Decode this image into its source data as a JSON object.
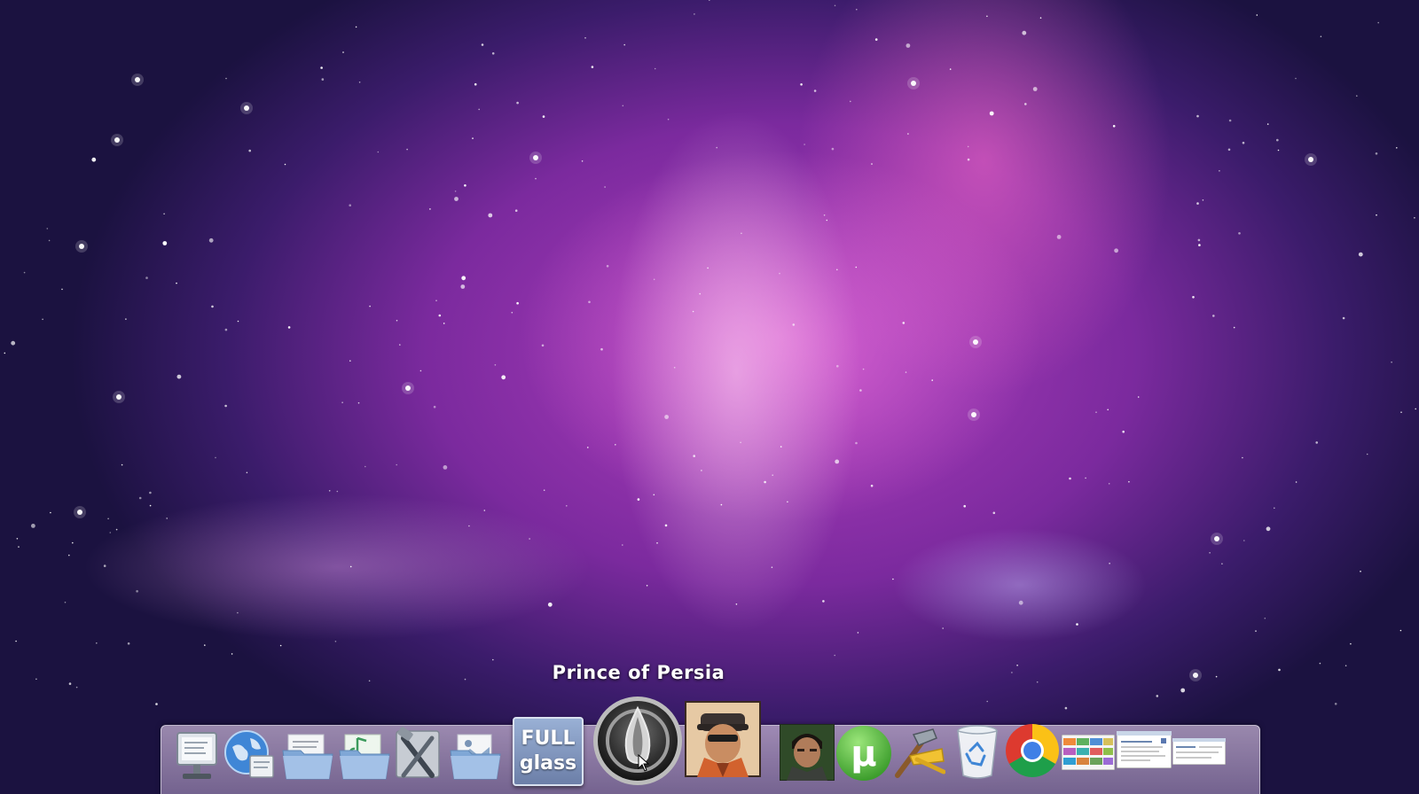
{
  "desktop": {
    "wallpaper": "aurora-galaxy",
    "colors": {
      "sky_dark": "#1b1240",
      "aurora_pink": "#e86ad8",
      "aurora_purple": "#8a3cb0"
    }
  },
  "dock": {
    "tooltip": "Prince of Persia",
    "items": [
      {
        "name": "computer-icon"
      },
      {
        "name": "network-globe-icon"
      },
      {
        "name": "documents-folder-icon"
      },
      {
        "name": "music-folder-icon"
      },
      {
        "name": "developer-tools-icon"
      },
      {
        "name": "pictures-folder-icon"
      },
      {
        "name": "full-glass-icon",
        "line1": "FULL",
        "line2": "glass"
      },
      {
        "name": "prince-of-persia-icon"
      },
      {
        "name": "game-character-icon"
      },
      {
        "name": "game-soldier-icon"
      },
      {
        "name": "utorrent-icon",
        "glyph": "µ"
      },
      {
        "name": "build-tools-icon"
      },
      {
        "name": "recycle-bin-icon"
      },
      {
        "name": "chrome-icon"
      },
      {
        "name": "window-thumbnail-1-icon"
      },
      {
        "name": "window-thumbnail-2-icon"
      },
      {
        "name": "window-thumbnail-3-icon"
      }
    ]
  }
}
